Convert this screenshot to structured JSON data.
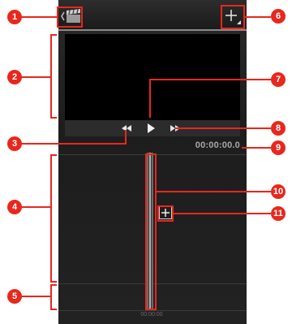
{
  "video": {
    "timecode": "00:00:00.0",
    "ruler_time": "00:00:00"
  },
  "callouts": {
    "c1": "1",
    "c2": "2",
    "c3": "3",
    "c4": "4",
    "c5": "5",
    "c6": "6",
    "c7": "7",
    "c8": "8",
    "c9": "9",
    "c10": "10",
    "c11": "11"
  },
  "icons": {
    "back": "back-chevron-icon",
    "clapper": "clapperboard-icon",
    "add": "add-media-icon",
    "play": "play-icon",
    "rewind": "rewind-icon",
    "fast_forward": "fast-forward-icon",
    "add_clip": "add-clip-icon"
  },
  "colors": {
    "callout": "#e8271d",
    "screen_bg": "#222222",
    "preview_bg": "#000000",
    "timecode": "#a8a8a8"
  }
}
